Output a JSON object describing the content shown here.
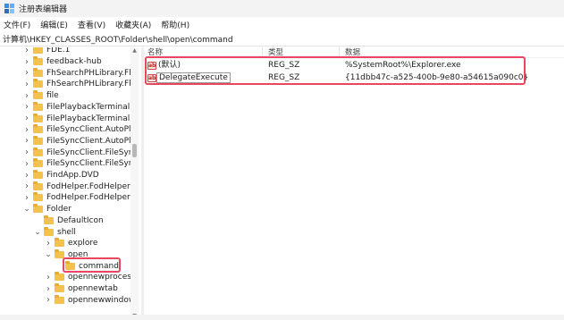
{
  "window": {
    "title": "注册表编辑器"
  },
  "menu": [
    "文件(F)",
    "编辑(E)",
    "查看(V)",
    "收藏夹(A)",
    "帮助(H)"
  ],
  "address": "计算机\\HKEY_CLASSES_ROOT\\Folder\\shell\\open\\command",
  "tree": [
    {
      "label": "FDE.1",
      "depth": 0,
      "chevron": "right"
    },
    {
      "label": "feedback-hub",
      "depth": 0,
      "chevron": "right"
    },
    {
      "label": "FhSearchPHLibrary.Fh",
      "depth": 0,
      "chevron": "right"
    },
    {
      "label": "FhSearchPHLibrary.Fh",
      "depth": 0,
      "chevron": "right"
    },
    {
      "label": "file",
      "depth": 0,
      "chevron": "right"
    },
    {
      "label": "FilePlaybackTerminal.I",
      "depth": 0,
      "chevron": "right"
    },
    {
      "label": "FilePlaybackTerminal.I",
      "depth": 0,
      "chevron": "right"
    },
    {
      "label": "FileSyncClient.AutoPla",
      "depth": 0,
      "chevron": "right"
    },
    {
      "label": "FileSyncClient.AutoPla",
      "depth": 0,
      "chevron": "right"
    },
    {
      "label": "FileSyncClient.FileSync",
      "depth": 0,
      "chevron": "right"
    },
    {
      "label": "FileSyncClient.FileSync",
      "depth": 0,
      "chevron": "right"
    },
    {
      "label": "FindApp.DVD",
      "depth": 0,
      "chevron": "right"
    },
    {
      "label": "FodHelper.FodHelperC",
      "depth": 0,
      "chevron": "right"
    },
    {
      "label": "FodHelper.FodHelperC",
      "depth": 0,
      "chevron": "right"
    },
    {
      "label": "Folder",
      "depth": 0,
      "chevron": "down"
    },
    {
      "label": "DefaultIcon",
      "depth": 1,
      "chevron": ""
    },
    {
      "label": "shell",
      "depth": 1,
      "chevron": "down"
    },
    {
      "label": "explore",
      "depth": 2,
      "chevron": "right"
    },
    {
      "label": "open",
      "depth": 2,
      "chevron": "down"
    },
    {
      "label": "command",
      "depth": 3,
      "chevron": ""
    },
    {
      "label": "opennewprocess",
      "depth": 2,
      "chevron": "right"
    },
    {
      "label": "opennewtab",
      "depth": 2,
      "chevron": "right"
    },
    {
      "label": "opennewwindow",
      "depth": 2,
      "chevron": "right"
    }
  ],
  "list": {
    "columns": [
      "名称",
      "类型",
      "数据"
    ],
    "rows": [
      {
        "icon": "ab",
        "name": "(默认)",
        "type": "REG_SZ",
        "data": "%SystemRoot%\\Explorer.exe"
      },
      {
        "icon": "ab",
        "name": "DelegateExecute",
        "type": "REG_SZ",
        "data": "{11dbb47c-a525-400b-9e80-a54615a090c0}"
      }
    ]
  },
  "icons": {
    "app": "registry-editor-icon",
    "folder": "folder-icon",
    "string_value": "string-value-icon",
    "expand": "chevron-right-icon",
    "collapse": "chevron-down-icon"
  },
  "colors": {
    "highlight": "#e8475e",
    "folder": "#f2c14e",
    "selection": "#f2c14e"
  }
}
